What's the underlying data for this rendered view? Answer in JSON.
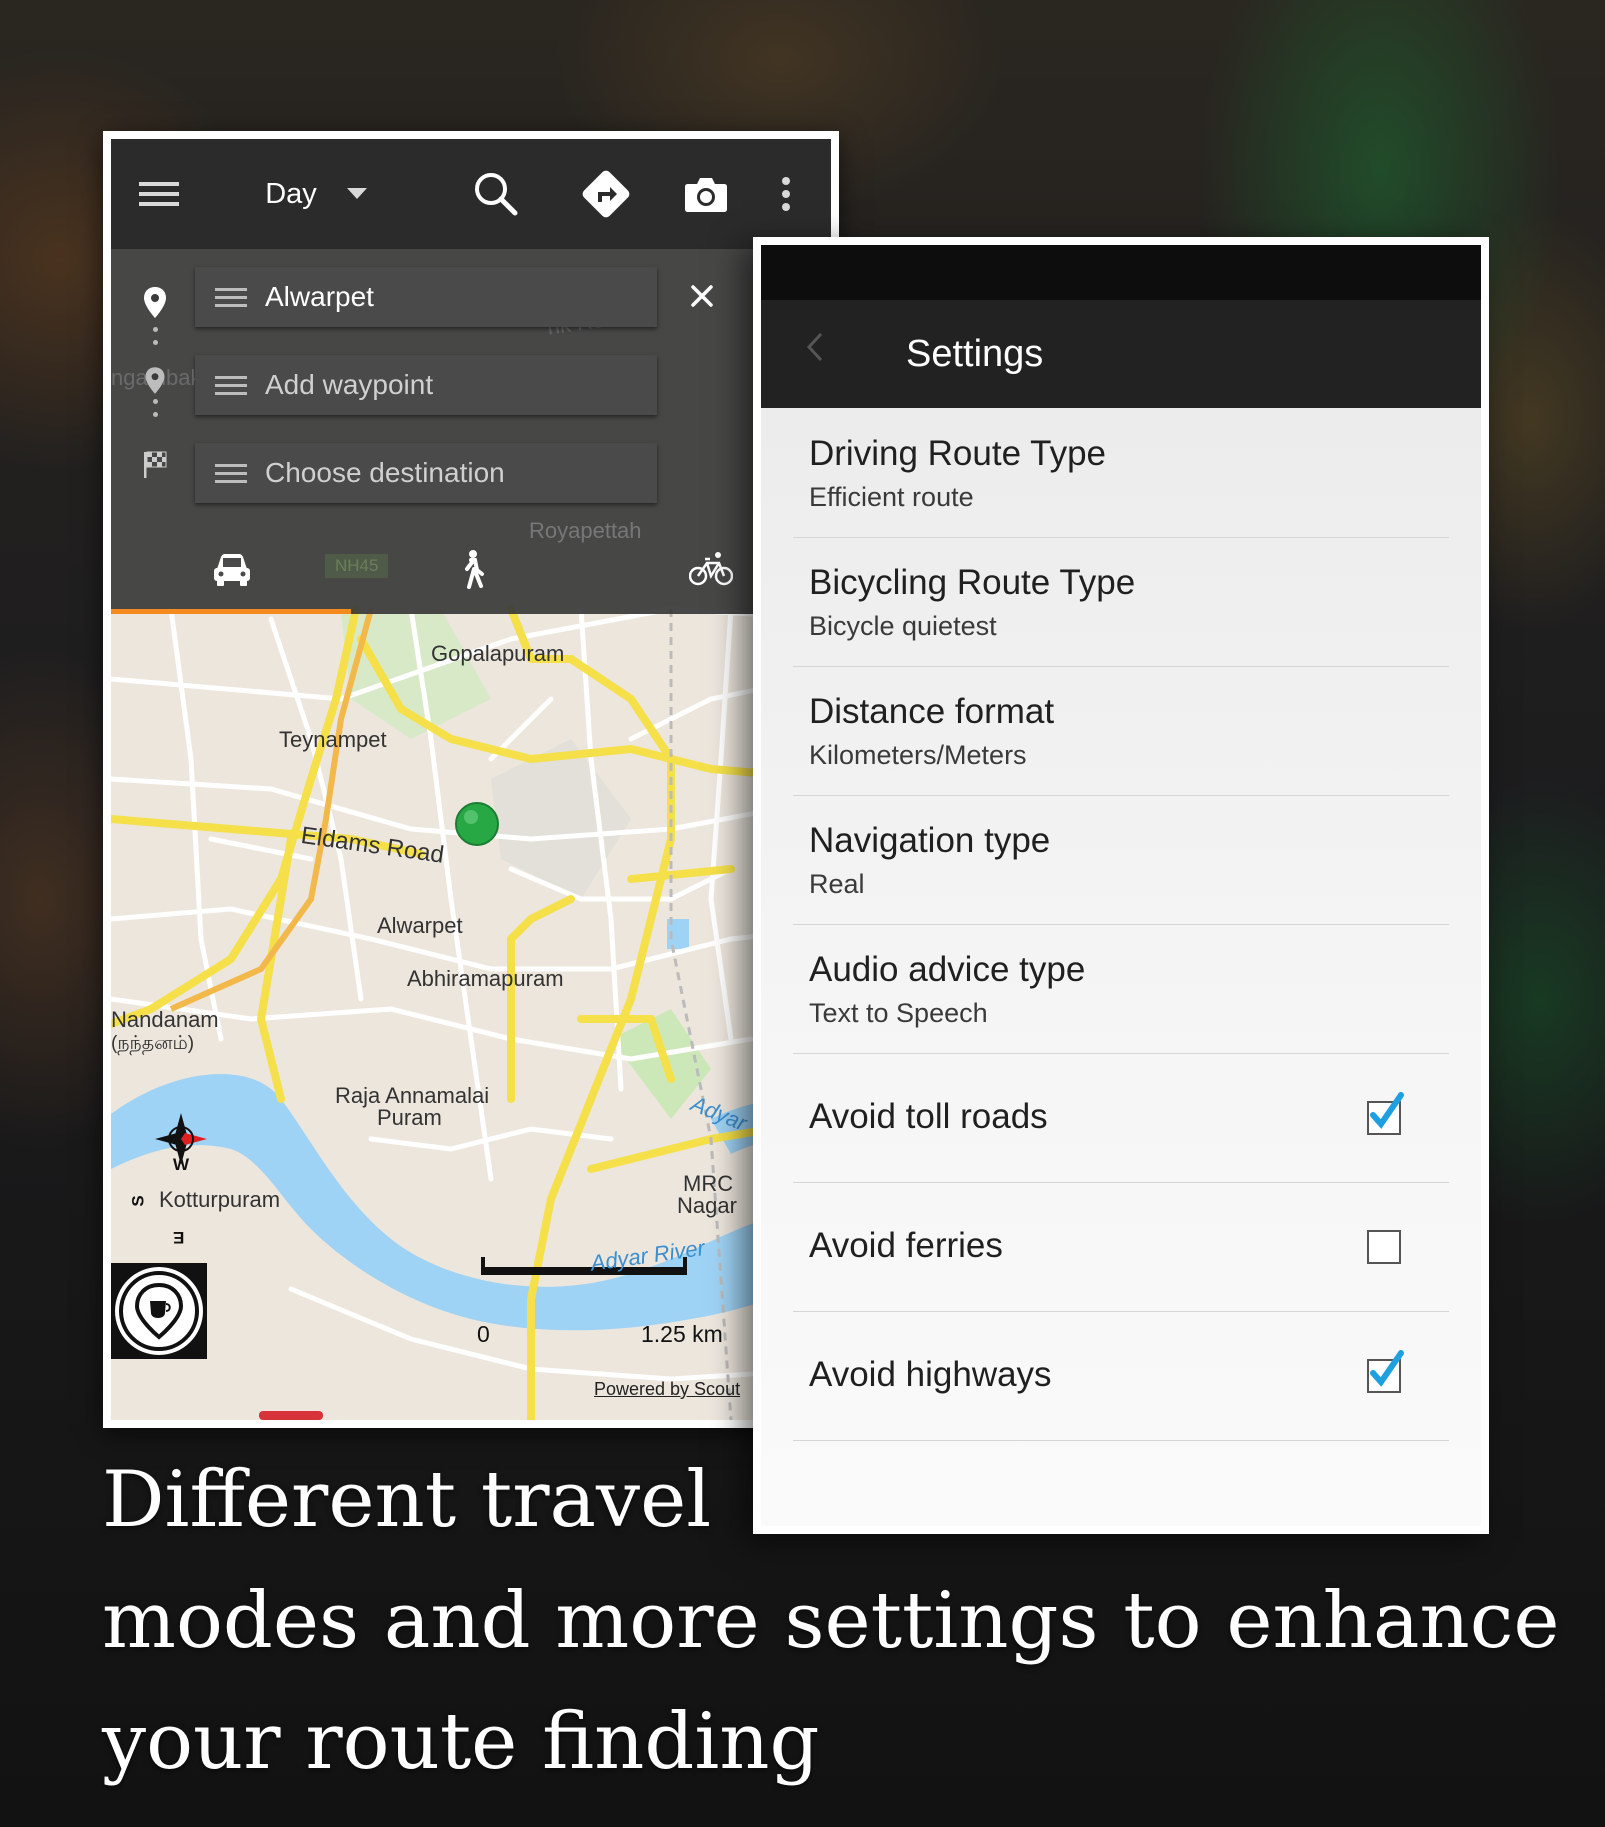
{
  "toolbar": {
    "menu_icon": "hamburger-menu-icon",
    "mode_label": "Day",
    "icons": [
      "search-icon",
      "directions-icon",
      "camera-icon",
      "more-vert-icon"
    ]
  },
  "route": {
    "origin_value": "Alwarpet",
    "waypoint_placeholder": "Add waypoint",
    "destination_placeholder": "Choose destination",
    "travel_modes": [
      "car-icon",
      "walking-icon",
      "bicycle-icon"
    ],
    "selected_mode": "car"
  },
  "map": {
    "labels": {
      "link_road": "nk Road",
      "nungambakkam": "ngambakkam",
      "royapettah": "Royapettah",
      "nh45": "NH45",
      "gopalapuram": "Gopalapuram",
      "teynampet": "Teynampet",
      "eldams_road": "Eldams Road",
      "alwarpet": "Alwarpet",
      "abhiramapuram": "Abhiramapuram",
      "nandanam": "Nandanam",
      "nandanam_tamil": "(நந்தனம்)",
      "raja_annamalai_1": "Raja Annamalai",
      "raja_annamalai_2": "Puram",
      "adyar_top": "Adyar",
      "mrc_1": "MRC",
      "mrc_2": "Nagar",
      "kotturpuram": "Kotturpuram",
      "adyar_river": "Adyar River",
      "compass_w": "W",
      "compass_s": "S",
      "compass_e": "E"
    },
    "scale_start": "0",
    "scale_end": "1.25 km",
    "attribution": "Powered by Scout",
    "colors": {
      "major_road": "#f5e04a",
      "water": "#9fd3f5",
      "park": "#cde8b8",
      "location_dot": "#27a844"
    }
  },
  "settings": {
    "title": "Settings",
    "items": [
      {
        "title": "Driving Route Type",
        "subtitle": "Efficient route"
      },
      {
        "title": "Bicycling Route Type",
        "subtitle": "Bicycle quietest"
      },
      {
        "title": "Distance format",
        "subtitle": "Kilometers/Meters"
      },
      {
        "title": "Navigation type",
        "subtitle": "Real"
      },
      {
        "title": "Audio advice type",
        "subtitle": "Text to Speech"
      }
    ],
    "toggles": [
      {
        "title": "Avoid toll roads",
        "checked": true
      },
      {
        "title": "Avoid ferries",
        "checked": false
      },
      {
        "title": "Avoid highways",
        "checked": true
      }
    ],
    "check_color": "#1ea0e0"
  },
  "caption": {
    "line1": "Different travel",
    "line2": "modes and more settings to enhance",
    "line3": "your route finding"
  }
}
